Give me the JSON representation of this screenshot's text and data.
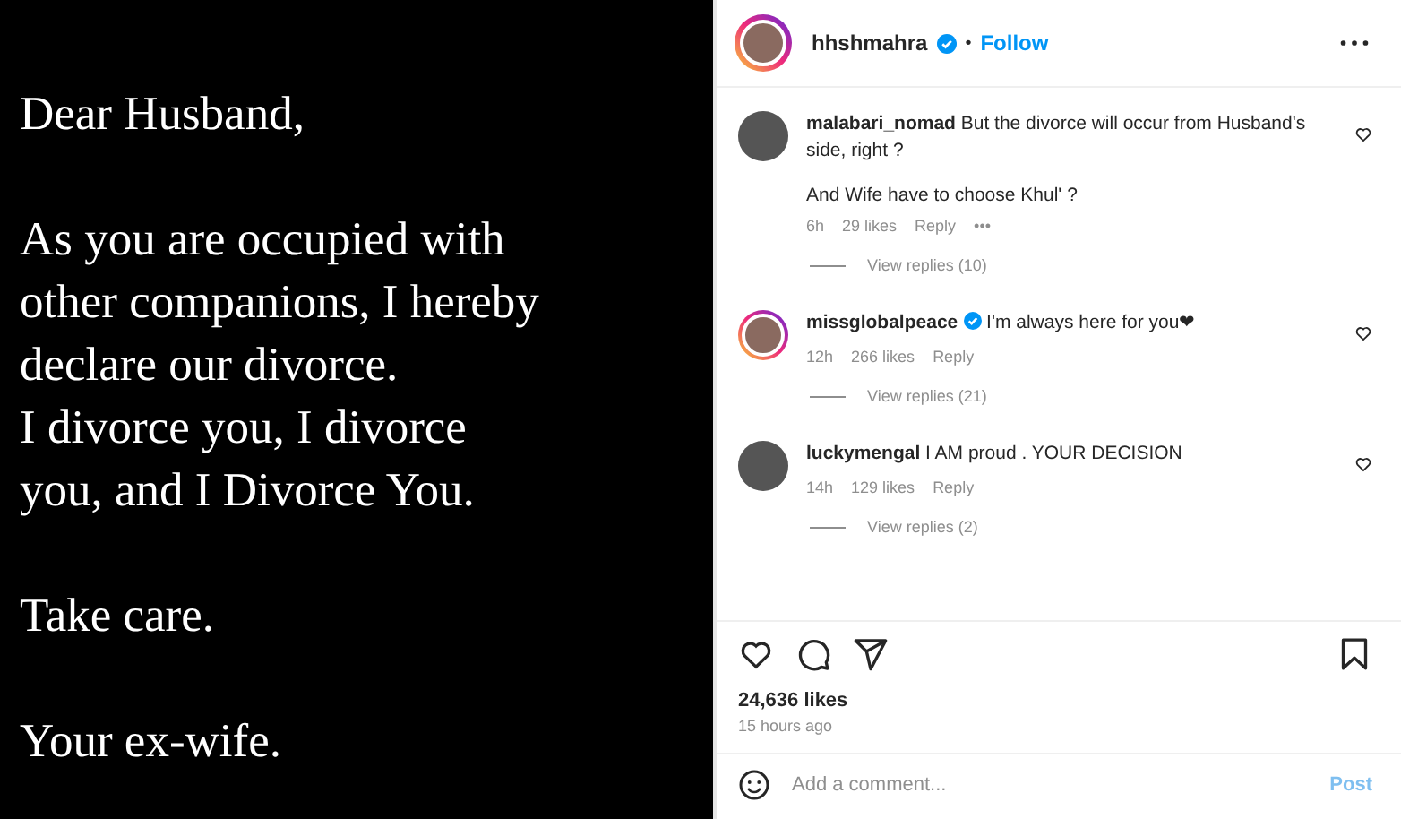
{
  "post_image": {
    "paragraphs": [
      [
        "Dear Husband,"
      ],
      [
        "As you are occupied with",
        "other companions, I hereby",
        "declare our divorce.",
        "I divorce you, I divorce",
        "you, and I Divorce You."
      ],
      [
        "Take care."
      ],
      [
        "Your ex-wife."
      ]
    ]
  },
  "header": {
    "username": "hhshmahra",
    "verified": true,
    "separator": "•",
    "follow": "Follow",
    "story_ring": true
  },
  "comments": [
    {
      "username": "malabari_nomad",
      "verified": false,
      "story_ring": false,
      "text": "But the divorce will occur from Husband's side, right ?",
      "extra": "And Wife have to choose Khul' ?",
      "time": "6h",
      "likes": "29 likes",
      "reply": "Reply",
      "more": "•••",
      "view_replies": "View replies (10)"
    },
    {
      "username": "missglobalpeace",
      "verified": true,
      "story_ring": true,
      "text": "I'm always here for you❤",
      "time": "12h",
      "likes": "266 likes",
      "reply": "Reply",
      "view_replies": "View replies (21)"
    },
    {
      "username": "luckymengal",
      "verified": false,
      "story_ring": false,
      "text": "I AM proud . YOUR DECISION",
      "time": "14h",
      "likes": "129 likes",
      "reply": "Reply",
      "view_replies": "View replies (2)"
    }
  ],
  "likes": "24,636 likes",
  "posted": "15 hours ago",
  "comment_box": {
    "placeholder": "Add a comment...",
    "post": "Post",
    "post_disabled": true
  }
}
